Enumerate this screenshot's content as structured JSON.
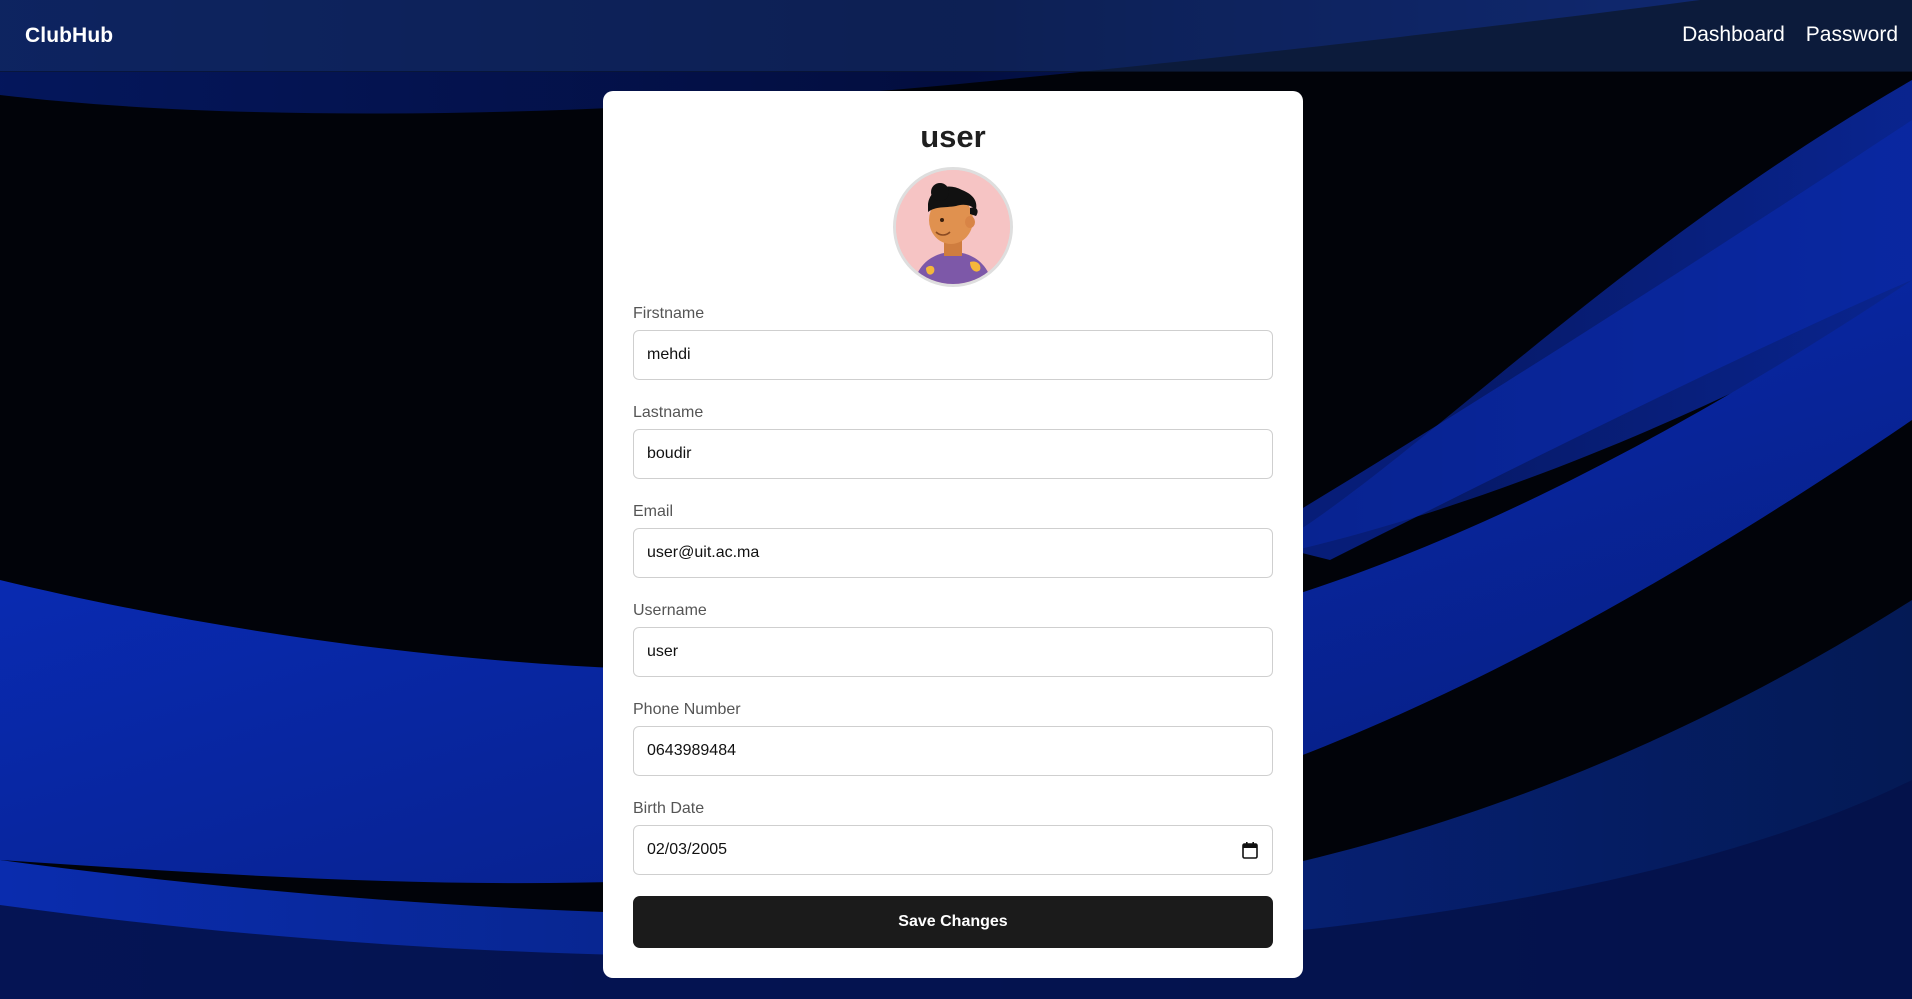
{
  "nav": {
    "brand": "ClubHub",
    "links": [
      {
        "label": "Dashboard"
      },
      {
        "label": "Password"
      }
    ]
  },
  "profile": {
    "title": "user",
    "fields": {
      "firstname": {
        "label": "Firstname",
        "value": "mehdi"
      },
      "lastname": {
        "label": "Lastname",
        "value": "boudir"
      },
      "email": {
        "label": "Email",
        "value": "user@uit.ac.ma"
      },
      "username": {
        "label": "Username",
        "value": "user"
      },
      "phone": {
        "label": "Phone Number",
        "value": "0643989484"
      },
      "birthdate": {
        "label": "Birth Date",
        "value": "02/03/2005"
      }
    },
    "save_label": "Save Changes"
  },
  "icons": {
    "calendar": "calendar-icon",
    "avatar": "user-avatar-illustration"
  },
  "colors": {
    "accent_blue": "#0a33b8",
    "button_bg": "#1b1b1b",
    "card_bg": "#ffffff"
  }
}
